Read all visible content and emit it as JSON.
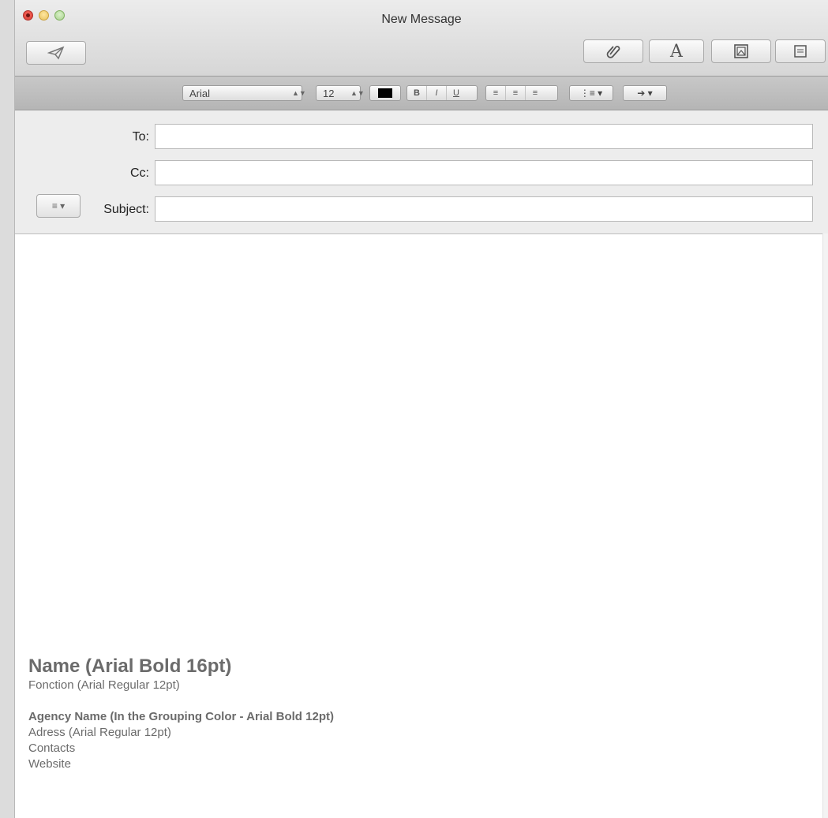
{
  "window": {
    "title": "New Message"
  },
  "toolbar": {
    "send_icon": "paper-plane-icon",
    "attach_icon": "paperclip-icon",
    "fonts_label": "A",
    "photo_icon": "photo-browser-icon",
    "stationery_icon": "stationery-icon"
  },
  "format": {
    "font": "Arial",
    "size": "12",
    "color": "#000000",
    "bold": "B",
    "italic": "I",
    "underline": "U"
  },
  "headers": {
    "to_label": "To:",
    "to_value": "",
    "cc_label": "Cc:",
    "cc_value": "",
    "subject_label": "Subject:",
    "subject_value": ""
  },
  "signature": {
    "name": "Name (Arial Bold 16pt)",
    "function": "Fonction (Arial Regular 12pt)",
    "agency": "Agency Name (In the Grouping Color - Arial Bold 12pt)",
    "address": "Adress (Arial Regular 12pt)",
    "contacts": "Contacts",
    "website": "Website"
  }
}
